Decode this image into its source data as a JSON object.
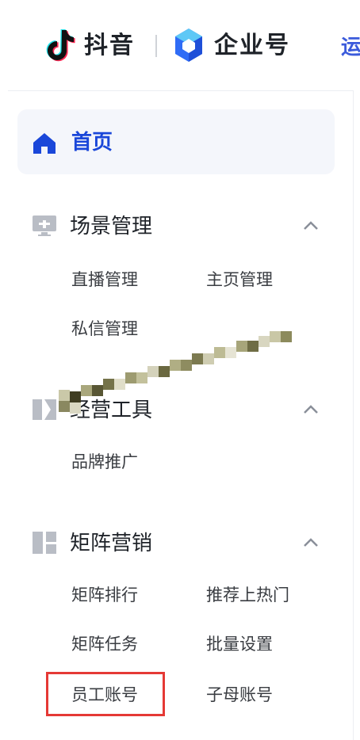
{
  "header": {
    "douyin_logo_text": "抖音",
    "enterprise_logo_text": "企业号",
    "truncated_link_text": "运"
  },
  "sidebar": {
    "home": {
      "label": "首页",
      "icon": "home-icon",
      "active": true
    },
    "groups": [
      {
        "label": "场景管理",
        "icon": "monitor-icon",
        "expanded": true,
        "items": [
          "直播管理",
          "主页管理",
          "私信管理"
        ]
      },
      {
        "label": "经营工具",
        "icon": "tools-icon",
        "expanded": true,
        "items": [
          "品牌推广"
        ]
      },
      {
        "label": "矩阵营销",
        "icon": "grid-icon",
        "expanded": true,
        "items": [
          "矩阵排行",
          "推荐上热门",
          "矩阵任务",
          "批量设置",
          "员工账号",
          "子母账号"
        ]
      }
    ]
  },
  "colors": {
    "accent": "#1a47d9",
    "home_bg": "#f4f6fb",
    "highlight_border": "#e53935",
    "icon_gray": "#8a8f99"
  }
}
